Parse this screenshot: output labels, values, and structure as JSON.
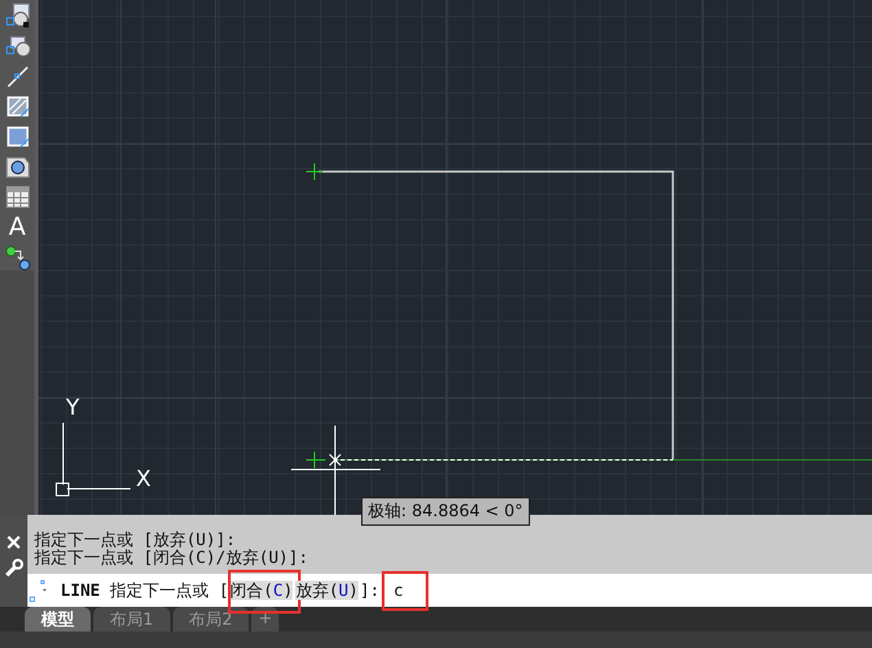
{
  "toolbar": {
    "text_tool_glyph": "A"
  },
  "canvas": {
    "axis_labels": {
      "y": "Y",
      "x": "X"
    },
    "tooltip": "极轴: 84.8864 < 0°"
  },
  "command_line": {
    "history": [
      "指定下一点或 [放弃(U)]:",
      "指定下一点或 [闭合(C)/放弃(U)]:"
    ],
    "command": "LINE",
    "prompt": "指定下一点或",
    "open_bracket": "[",
    "options": [
      {
        "label": "闭合(",
        "key": "C",
        "close": ")",
        "highlighted": true
      },
      {
        "label": "放弃(",
        "key": "U",
        "close": ")",
        "highlighted": false
      }
    ],
    "close_bracket": "]:",
    "value": "c",
    "value_highlighted": true
  },
  "tabs": [
    {
      "label": "模型",
      "selected": true
    },
    {
      "label": "布局1",
      "selected": false
    },
    {
      "label": "布局2",
      "selected": false
    },
    {
      "label": "+",
      "selected": false,
      "kind": "add"
    }
  ]
}
